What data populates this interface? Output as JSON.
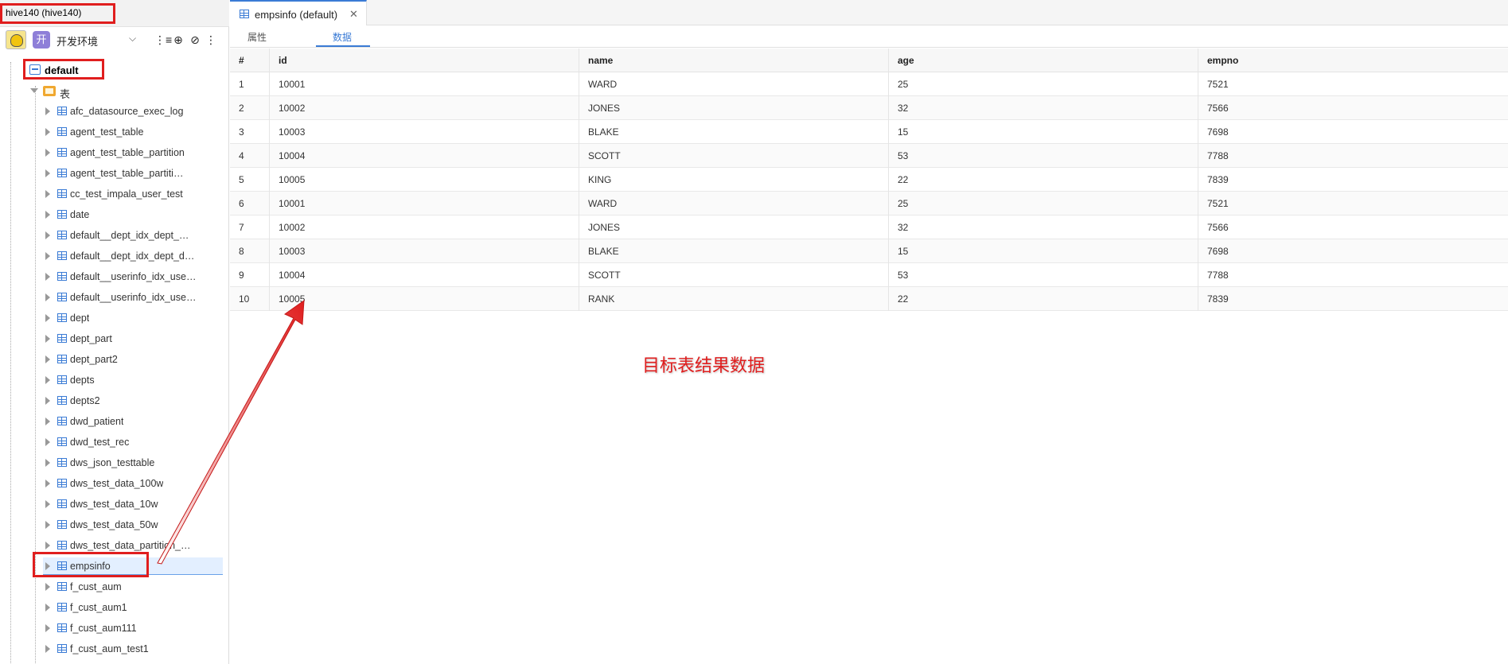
{
  "connection": {
    "title": "hive140 (hive140)"
  },
  "toolbar": {
    "env_badge": "开",
    "env_label": "开发环境",
    "chevron": "⌵",
    "icons": [
      "list-filter-icon",
      "locate-icon",
      "link-icon",
      "more-icon"
    ]
  },
  "tree": {
    "database": "default",
    "folder": "表",
    "tables": [
      "afc_datasource_exec_log",
      "agent_test_table",
      "agent_test_table_partition",
      "agent_test_table_partiti…",
      "cc_test_impala_user_test",
      "date",
      "default__dept_idx_dept_…",
      "default__dept_idx_dept_d…",
      "default__userinfo_idx_use…",
      "default__userinfo_idx_use…",
      "dept",
      "dept_part",
      "dept_part2",
      "depts",
      "depts2",
      "dwd_patient",
      "dwd_test_rec",
      "dws_json_testtable",
      "dws_test_data_100w",
      "dws_test_data_10w",
      "dws_test_data_50w",
      "dws_test_data_partition_…",
      "empsinfo",
      "f_cust_aum",
      "f_cust_aum1",
      "f_cust_aum111",
      "f_cust_aum_test1"
    ],
    "selected_index": 22
  },
  "editor": {
    "tab_label": "empsinfo (default)",
    "close": "✕",
    "subtabs": [
      "属性",
      "数据"
    ],
    "active_subtab": 1
  },
  "grid": {
    "columns": [
      "#",
      "id",
      "name",
      "age",
      "empno"
    ],
    "rows": [
      [
        "1",
        "10001",
        "WARD",
        "25",
        "7521"
      ],
      [
        "2",
        "10002",
        "JONES",
        "32",
        "7566"
      ],
      [
        "3",
        "10003",
        "BLAKE",
        "15",
        "7698"
      ],
      [
        "4",
        "10004",
        "SCOTT",
        "53",
        "7788"
      ],
      [
        "5",
        "10005",
        "KING",
        "22",
        "7839"
      ],
      [
        "6",
        "10001",
        "WARD",
        "25",
        "7521"
      ],
      [
        "7",
        "10002",
        "JONES",
        "32",
        "7566"
      ],
      [
        "8",
        "10003",
        "BLAKE",
        "15",
        "7698"
      ],
      [
        "9",
        "10004",
        "SCOTT",
        "53",
        "7788"
      ],
      [
        "10",
        "10005",
        "RANK",
        "22",
        "7839"
      ]
    ]
  },
  "annotation": {
    "text": "目标表结果数据",
    "color": "#e01e1e"
  },
  "colors": {
    "accent": "#3a7bd5",
    "highlight": "#e01e1e",
    "env_badge": "#8e7fd8",
    "folder": "#f0a830"
  }
}
